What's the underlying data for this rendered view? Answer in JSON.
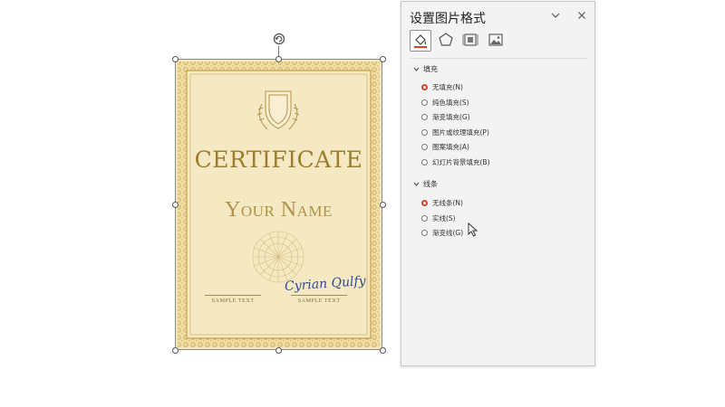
{
  "certificate": {
    "title": "CERTIFICATE",
    "name": "Your Name",
    "sample_left": "SAMPLE TEXT",
    "sample_right": "SAMPLE TEXT",
    "signature": "Cyrian Qulfy"
  },
  "pane": {
    "title": "设置图片格式",
    "tabs": [
      "fill-line-icon",
      "effects-pentagon-icon",
      "size-layout-icon",
      "picture-icon"
    ],
    "fill_section": {
      "label": "填充",
      "options": [
        {
          "label": "无填充(N)",
          "selected": true
        },
        {
          "label": "纯色填充(S)",
          "selected": false
        },
        {
          "label": "渐变填充(G)",
          "selected": false
        },
        {
          "label": "图片或纹理填充(P)",
          "selected": false
        },
        {
          "label": "图案填充(A)",
          "selected": false
        },
        {
          "label": "幻灯片背景填充(B)",
          "selected": false
        }
      ]
    },
    "line_section": {
      "label": "线条",
      "options": [
        {
          "label": "无线条(N)",
          "selected": true
        },
        {
          "label": "实线(S)",
          "selected": false
        },
        {
          "label": "渐变线(G)",
          "selected": false
        }
      ]
    }
  },
  "colors": {
    "accent_radio": "#d6412d",
    "certificate_bg": "#f4e7bf",
    "certificate_gold": "#9c7d2b"
  }
}
